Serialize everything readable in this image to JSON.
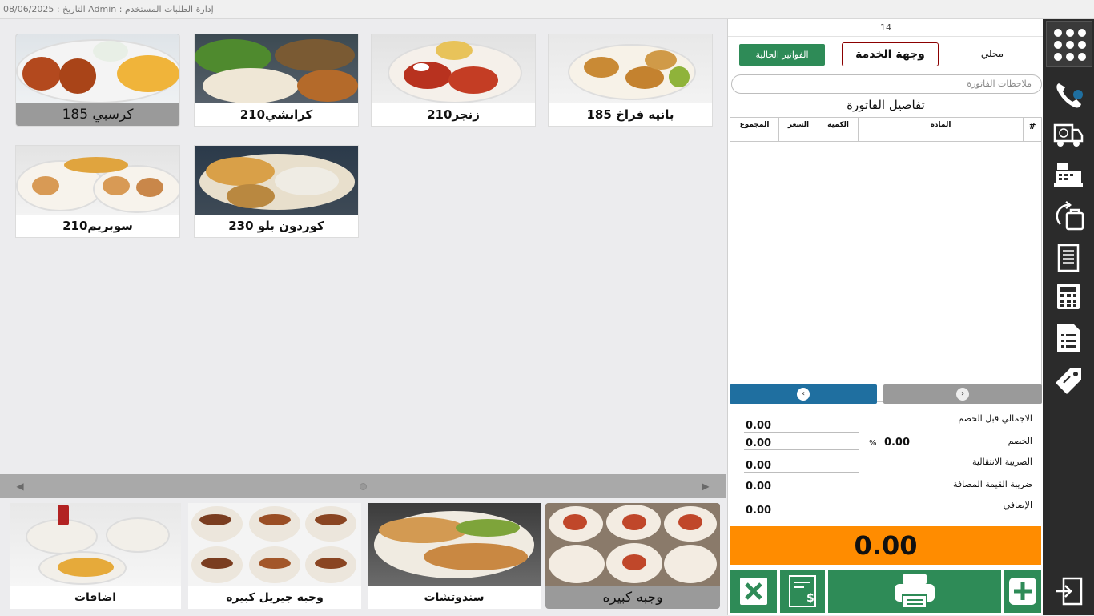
{
  "titlebar": {
    "text": "08/06/2025 : التاريخ  Admin : إدارة الطلبات المستخدم"
  },
  "products": [
    {
      "label": "بانيه فراخ 185"
    },
    {
      "label": "زنجر210"
    },
    {
      "label": "كرانشي210"
    },
    {
      "label": "كرسبي 185"
    },
    {
      "label": "كوردون بلو 230"
    },
    {
      "label": "سوبريم210"
    }
  ],
  "categories": [
    {
      "label": "وجبه كبيره"
    },
    {
      "label": "سندوتشات"
    },
    {
      "label": "وجبه جيريل كبيره"
    },
    {
      "label": "اضافات"
    }
  ],
  "invoice": {
    "order_number": "14",
    "current_invoices_label": "الفواتير الحالية",
    "service_label": "وجهة الخدمة",
    "local_label": "محلي",
    "notes_placeholder": "ملاحظات الفاتورة",
    "title": "تفاصيل الفاتورة",
    "columns": [
      "#",
      "المادة",
      "الكمية",
      "السعر",
      "المجموع"
    ],
    "totals": {
      "subtotal_label": "الاجمالي قبل الخصم",
      "subtotal": "0.00",
      "discount_label": "الخصم",
      "discount": "0.00",
      "discount_percent": "0.00",
      "percent_sign": "%",
      "transition_tax_label": "الضريبة الانتقالية",
      "transition_tax": "0.00",
      "vat_label": "ضريبة القيمة المضافة",
      "vat": "0.00",
      "extra_label": "الإضافي",
      "extra": "0.00"
    },
    "grand_total": "0.00"
  },
  "colors": {
    "accent_green": "#2e8b57",
    "grand_total_bg": "#ff8c00",
    "nav_blue": "#1f6fa0",
    "sidebar_bg": "#2b2b2b"
  },
  "sidebar_icons": [
    "apps-grid-icon",
    "phone-icon",
    "delivery-truck-icon",
    "cash-register-icon",
    "takeaway-bag-icon",
    "receipt-icon",
    "calculator-icon",
    "list-document-icon",
    "price-tag-icon",
    "exit-icon"
  ]
}
